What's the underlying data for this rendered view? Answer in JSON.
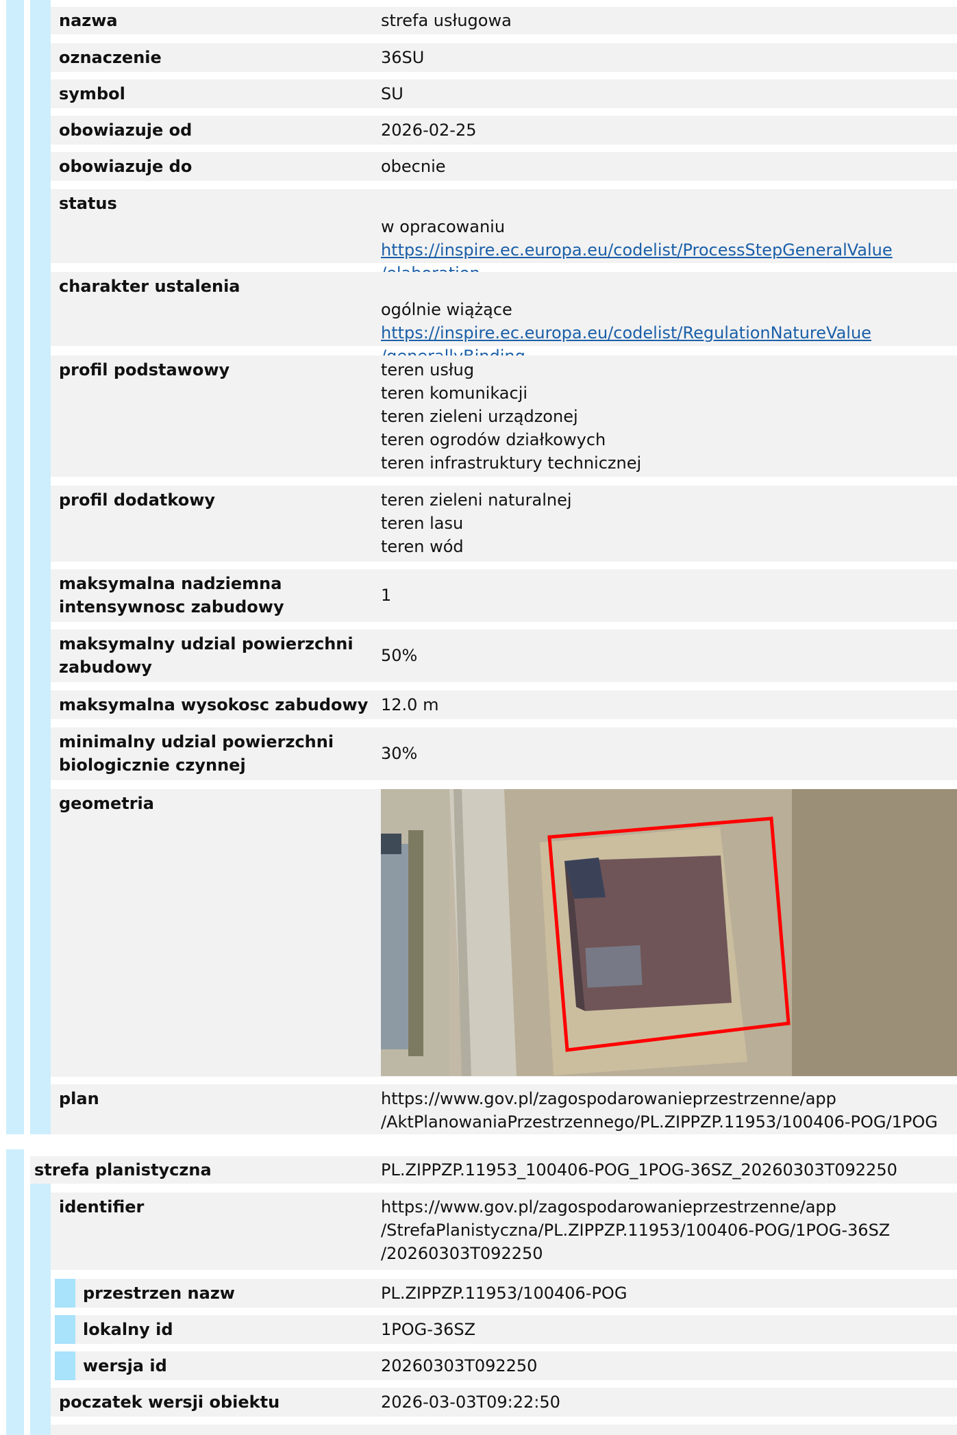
{
  "feature": {
    "rows": [
      {
        "key": "nazwa",
        "value": "strefa usługowa"
      },
      {
        "key": "oznaczenie",
        "value": "36SU"
      },
      {
        "key": "symbol",
        "value": "SU"
      },
      {
        "key": "obowiazuje od",
        "value": "2026-02-25"
      },
      {
        "key": "obowiazuje do",
        "value": "obecnie"
      },
      {
        "key": "status",
        "value": "w opracowaniu",
        "link": "https://inspire.ec.europa.eu/codelist/ProcessStepGeneralValue\n/elaboration"
      },
      {
        "key": "charakter ustalenia",
        "value": "ogólnie wiążące",
        "link": "https://inspire.ec.europa.eu/codelist/RegulationNatureValue\n/generallyBinding"
      },
      {
        "key": "profil podstawowy",
        "value": "teren usług\nteren komunikacji\nteren zieleni urządzonej\nteren ogrodów działkowych\nteren infrastruktury technicznej"
      },
      {
        "key": "profil dodatkowy",
        "value": "teren zieleni naturalnej\nteren lasu\nteren wód"
      },
      {
        "key": "maksymalna nadziemna\nintensywnosc zabudowy",
        "value": "1"
      },
      {
        "key": "maksymalny udzial powierzchni\nzabudowy",
        "value": "50%"
      },
      {
        "key": "maksymalna wysokosc zabudowy",
        "value": "12.0 m"
      },
      {
        "key": "minimalny udzial powierzchni\nbiologicznie czynnej",
        "value": "30%"
      },
      {
        "key": "geometria",
        "value": ""
      },
      {
        "key": "plan",
        "value": "https://www.gov.pl/zagospodarowanieprzestrzenne/app\n/AktPlanowaniaPrzestrzennego/PL.ZIPPZP.11953/100406-POG/1POG"
      }
    ]
  },
  "strefa": {
    "header_key": "strefa planistyczna",
    "header_value": "PL.ZIPPZP.11953_100406-POG_1POG-36SZ_20260303T092250",
    "identifier_key": "identifier",
    "identifier_value": "https://www.gov.pl/zagospodarowanieprzestrzenne/app\n/StrefaPlanistyczna/PL.ZIPPZP.11953/100406-POG/1POG-36SZ\n/20260303T092250",
    "sub": [
      {
        "key": "przestrzen nazw",
        "value": "PL.ZIPPZP.11953/100406-POG"
      },
      {
        "key": "lokalny id",
        "value": "1POG-36SZ"
      },
      {
        "key": "wersja id",
        "value": "20260303T092250"
      }
    ],
    "poczatek_key": "poczatek wersji obiektu",
    "poczatek_value": "2026-03-03T09:22:50"
  },
  "colors": {
    "accent_bar": "#cdeefc",
    "accent_bar_dark": "#a8e2fb",
    "link": "#1a5fa8",
    "row_bg": "#f2f2f2",
    "polygon": "#ff0000"
  }
}
